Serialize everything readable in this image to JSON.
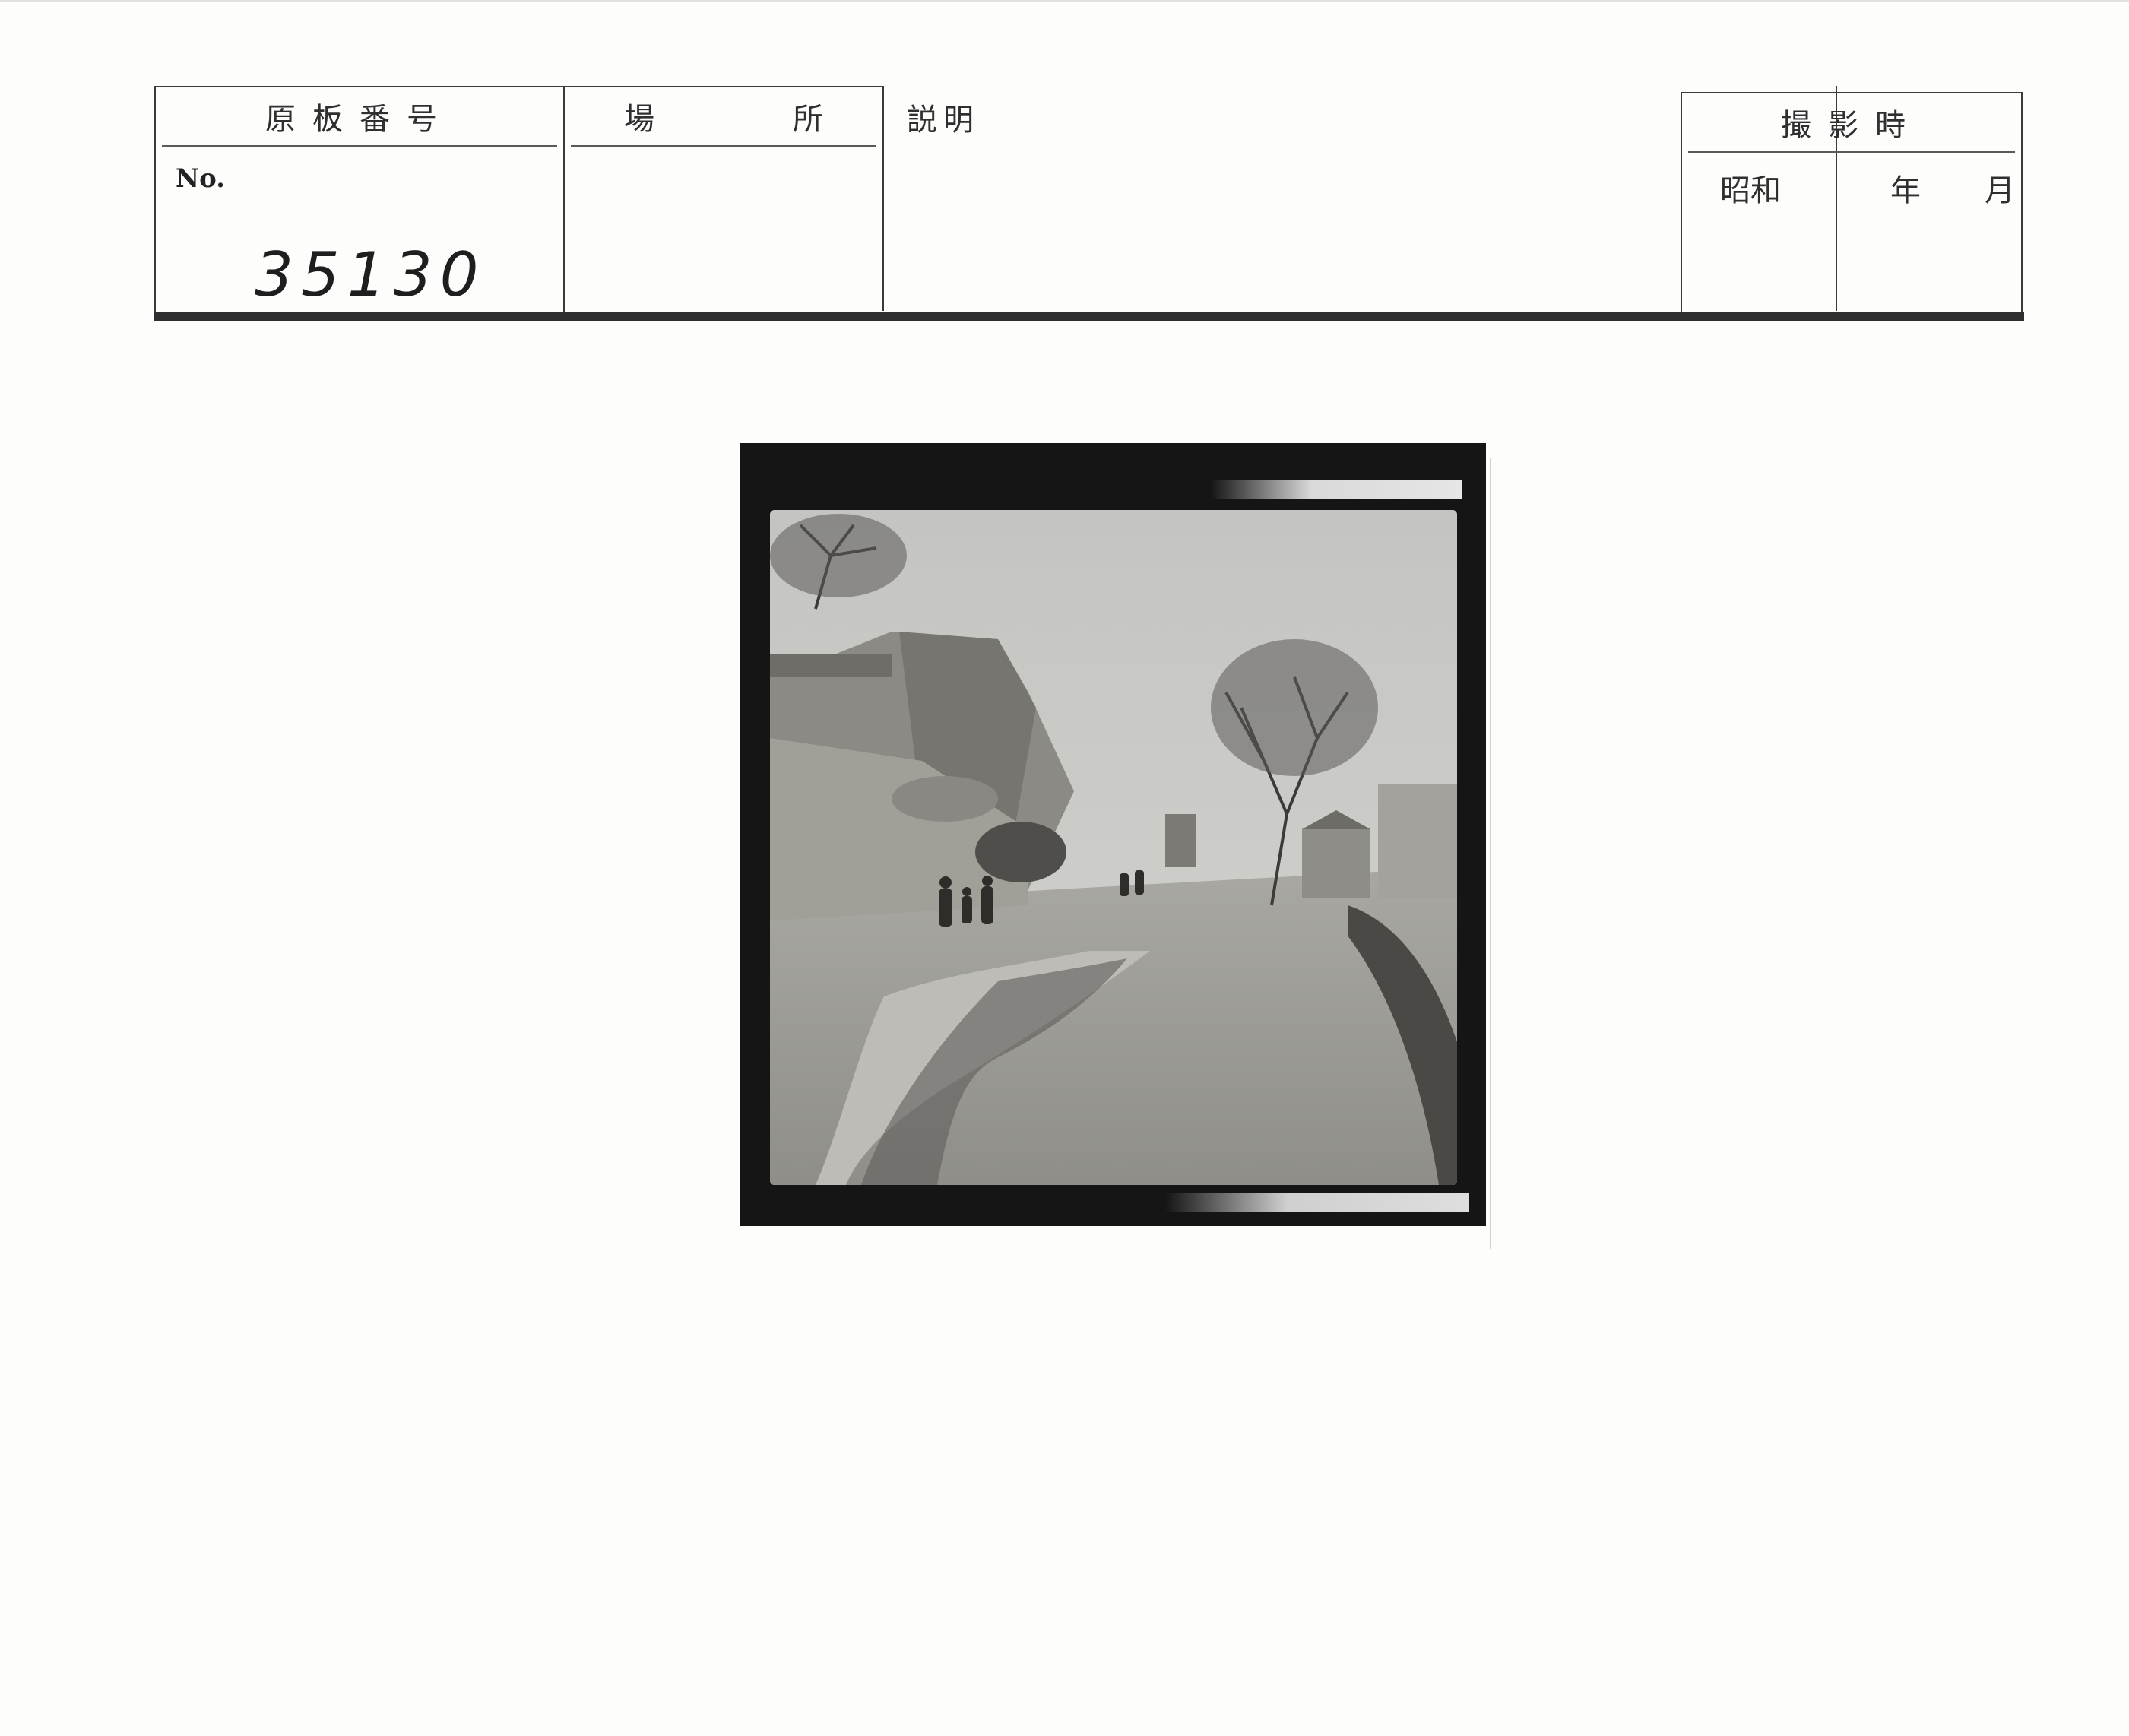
{
  "form": {
    "plate_number_header": "原板番号",
    "plate_no_label": "No.",
    "plate_number_value": "35130",
    "place_header_left": "場",
    "place_header_right": "所",
    "description_header": "説明",
    "shot_time_header": "撮影時",
    "era_label": "昭和",
    "year_label": "年",
    "month_label": "月"
  },
  "photo": {
    "icon": "photograph",
    "colors": {
      "frame": "#151515",
      "sky": "#c9c9c6",
      "ground": "#9d9c97"
    }
  }
}
